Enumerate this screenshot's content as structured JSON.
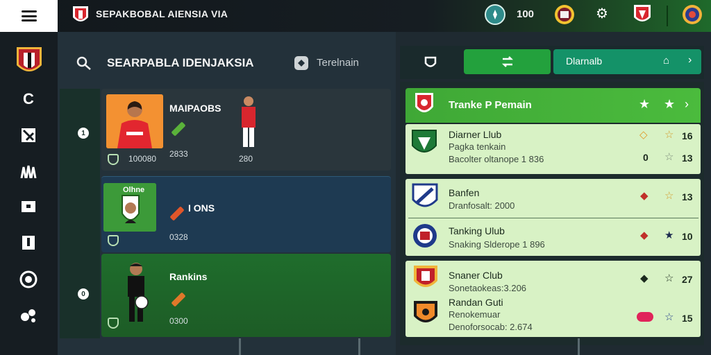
{
  "topbar": {
    "menu_icon": "hamburger-icon",
    "app_title": "SEPAKBOBAL AIENSIA VIA",
    "coin_count": "100",
    "icons": [
      "app-logo-icon",
      "compass-icon",
      "club-crest-icon",
      "gear-icon",
      "club-shield-icon",
      "globe-badge-icon"
    ]
  },
  "sidebar": {
    "items": [
      "club-shield-icon",
      "refresh-icon",
      "tactics-icon",
      "squad-icon",
      "message-icon",
      "card-icon",
      "ball-icon",
      "transfer-icon"
    ]
  },
  "main": {
    "title": "SEARPABLA IDENJAKSIA",
    "filter_label": "Terelnain",
    "rail_markers": [
      "1",
      "",
      "0"
    ],
    "cards": [
      {
        "name": "MAIPAOBS",
        "num_left": "100080",
        "num_mid": "2833",
        "num_right": "280"
      },
      {
        "photo_label": "Olhne",
        "name": "I ONS",
        "num_left": "0328"
      },
      {
        "name": "Rankins",
        "num_left": "0300"
      }
    ]
  },
  "right": {
    "toolbar": {
      "button_label": "Dlarnalb"
    },
    "panel_title": "Tranke P Pemain",
    "clubs": [
      {
        "name": "Diarner Llub",
        "sub1": "Pagka tenkain",
        "sub2": "Bacolter oltanope 1 836",
        "num1": "16",
        "num2": "13",
        "mini_left": "0"
      },
      {
        "name": "Banfen",
        "sub1": "Dranfosalt: 2000",
        "num1": "13"
      },
      {
        "name": "Tanking Ulub",
        "sub1": "Snaking Slderope 1 896",
        "num1": "10"
      },
      {
        "name": "Snaner Club",
        "sub1": "Sonetaokeas:3.206",
        "num1": "27"
      },
      {
        "name": "Randan Guti",
        "sub1": "Renokemuar",
        "sub2": "Denoforsocab: 2.674",
        "num1": "15"
      }
    ]
  },
  "colors": {
    "accent_green": "#23a13d",
    "teal_button": "#149268",
    "panel_green": "#4bbb3d",
    "club_card_bg": "#d8f2c5",
    "selected_card": "#1e3a52"
  }
}
